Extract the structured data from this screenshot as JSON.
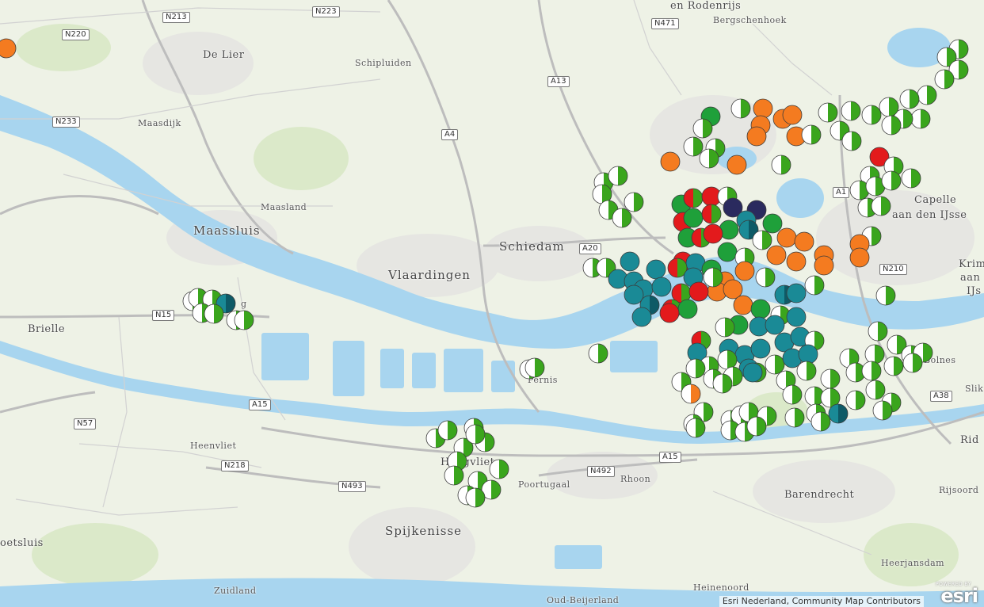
{
  "map": {
    "basemap_colors": {
      "land": "#eef2e6",
      "water": "#a8d5ef",
      "road": "#d9d9d9",
      "urban": "#e4e4e0"
    },
    "place_labels": [
      {
        "name": "Maassluis",
        "size": "big"
      },
      {
        "name": "Vlaardingen",
        "size": "big"
      },
      {
        "name": "Schiedam",
        "size": "big"
      },
      {
        "name": "Spijkenisse",
        "size": "big"
      },
      {
        "name": "De Lier",
        "size": "mid"
      },
      {
        "name": "Maasland",
        "size": "small"
      },
      {
        "name": "Maasdijk",
        "size": "small"
      },
      {
        "name": "Schipluiden",
        "size": "small"
      },
      {
        "name": "Bergschenhoek",
        "size": "small"
      },
      {
        "name": "en Rodenrijs",
        "size": "mid"
      },
      {
        "name": "Brielle",
        "size": "mid"
      },
      {
        "name": "Heenvliet",
        "size": "small"
      },
      {
        "name": "Poortugaal",
        "size": "small"
      },
      {
        "name": "Rhoon",
        "size": "small"
      },
      {
        "name": "Barendrecht",
        "size": "mid"
      },
      {
        "name": "Pernis",
        "size": "small"
      },
      {
        "name": "Hoogvliet",
        "size": "mid"
      },
      {
        "name": "Zuidland",
        "size": "small"
      },
      {
        "name": "Oud-Beijerland",
        "size": "small"
      },
      {
        "name": "Heinenoord",
        "size": "small"
      },
      {
        "name": "Heerjansdam",
        "size": "small"
      },
      {
        "name": "Rijsoord",
        "size": "small"
      },
      {
        "name": "Bolnes",
        "size": "small"
      },
      {
        "name": "Slik",
        "size": "small"
      },
      {
        "name": "Rid",
        "size": "mid"
      },
      {
        "name": "Capelle",
        "size": "mid"
      },
      {
        "name": "aan den IJsse",
        "size": "mid"
      },
      {
        "name": "Krim",
        "size": "mid"
      },
      {
        "name": "aan",
        "size": "mid"
      },
      {
        "name": "IJs",
        "size": "mid"
      },
      {
        "name": "oetsluis",
        "size": "mid"
      },
      {
        "name": "g",
        "size": "small"
      }
    ],
    "road_shields": [
      "N213",
      "N223",
      "N220",
      "N471",
      "A13",
      "N233",
      "A4",
      "A20",
      "A1",
      "N210",
      "N15",
      "A15",
      "N57",
      "N218",
      "N493",
      "N492",
      "A15",
      "A38"
    ],
    "attribution": "Esri Nederland, Community Map Contributors",
    "logo": {
      "powered_by": "POWERED BY",
      "name": "esri"
    }
  },
  "marker_legend_colors": {
    "green_white": [
      "#3aa51d",
      "#ffffff"
    ],
    "orange": "#f47b20",
    "red": "#e31a1c",
    "teal": "#1a8a96",
    "dark_teal": "#0e5a66",
    "green": "#1fa03a",
    "navy": "#2a2a5e",
    "red_green": [
      "#e31a1c",
      "#3aa51d"
    ],
    "orange_white": [
      "#f47b20",
      "#ffffff"
    ]
  }
}
